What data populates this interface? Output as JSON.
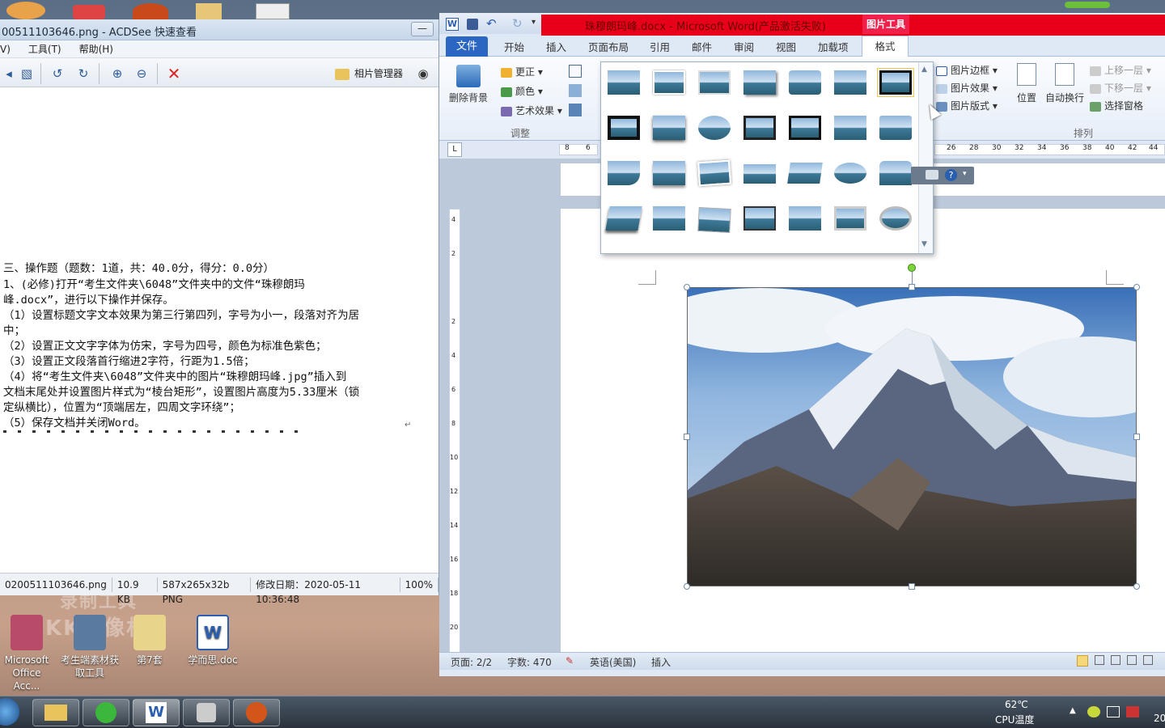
{
  "desktop": {
    "icons": [
      {
        "label": "Microsoft Office Acc..."
      },
      {
        "label": "考生端素材获取工具"
      },
      {
        "label": "第7套"
      },
      {
        "label": "学而思.doc"
      }
    ],
    "watermark1": "录制工具",
    "watermark2": "KK录像机"
  },
  "acdsee": {
    "title": "00511103646.png - ACDSee 快速查看",
    "min_label": "—",
    "menu": [
      "V)",
      "工具(T)",
      "帮助(H)"
    ],
    "toolbar_label": "相片管理器",
    "lines": [
      "三、操作题（题数：1道，共：40.0分，得分：0.0分）",
      "1、(必修)打开“考生文件夹\\6048”文件夹中的文件“珠穆朗玛",
      "峰.docx”，进行以下操作并保存。",
      "（1）设置标题文字文本效果为第三行第四列，字号为小一，段落对齐为居",
      "中；",
      "（2）设置正文文字字体为仿宋，字号为四号，颜色为标准色紫色；",
      "（3）设置正文段落首行缩进2字符，行距为1.5倍；",
      "（4）将“考生文件夹\\6048”文件夹中的图片“珠穆朗玛峰.jpg”插入到",
      "文档末尾处并设置图片样式为“棱台矩形”，设置图片高度为5.33厘米（锁",
      "定纵横比），位置为“顶端居左，四周文字环绕”；",
      "（5）保存文档并关闭Word。"
    ],
    "status": {
      "file": "0200511103646.png",
      "size": "10.9 KB",
      "dims": "587x265x32b PNG",
      "modified": "修改日期：2020-05-11 10:36:48",
      "zoom": "100%"
    }
  },
  "word": {
    "title": "珠穆朗玛峰.docx - Microsoft Word(产品激活失败)",
    "context_tab": "图片工具",
    "tabs": [
      "文件",
      "开始",
      "插入",
      "页面布局",
      "引用",
      "邮件",
      "审阅",
      "视图",
      "加载项",
      "格式"
    ],
    "ribbon": {
      "remove_bg": "删除背景",
      "corrections": "更正",
      "color": "颜色",
      "artistic": "艺术效果",
      "group_adjust": "调整",
      "border": "图片边框",
      "effects": "图片效果",
      "layout": "图片版式",
      "position": "位置",
      "wrap": "自动换行",
      "bring_forward": "上移一层",
      "send_backward": "下移一层",
      "selection_pane": "选择窗格",
      "group_arrange": "排列"
    },
    "ruler_left": [
      "8",
      "6"
    ],
    "ruler_right": [
      "26",
      "28",
      "30",
      "32",
      "34",
      "36",
      "38",
      "40",
      "42",
      "44"
    ],
    "vruler": [
      "4",
      "2",
      "2",
      "4",
      "6",
      "8",
      "10",
      "12",
      "14",
      "16",
      "18",
      "20"
    ],
    "status": {
      "page": "页面: 2/2",
      "words": "字数: 470",
      "lang": "英语(美国)",
      "mode": "插入"
    }
  },
  "taskbar": {
    "temp": "62℃",
    "cpu": "CPU温度",
    "clock": "20"
  }
}
